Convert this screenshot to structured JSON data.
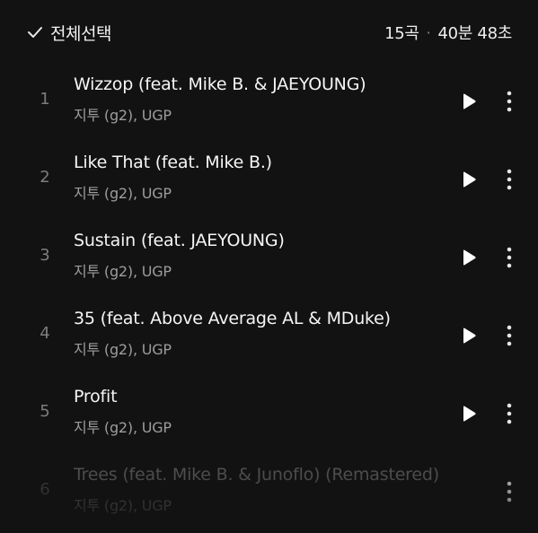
{
  "header": {
    "select_all_label": "전체선택",
    "track_count": "15곡",
    "separator": "·",
    "total_duration": "40분 48초"
  },
  "tracks": [
    {
      "number": "1",
      "title": "Wizzop (feat. Mike B. & JAEYOUNG)",
      "artist": "지투 (g2), UGP"
    },
    {
      "number": "2",
      "title": "Like That (feat. Mike B.)",
      "artist": "지투 (g2), UGP"
    },
    {
      "number": "3",
      "title": "Sustain (feat. JAEYOUNG)",
      "artist": "지투 (g2), UGP"
    },
    {
      "number": "4",
      "title": "35 (feat. Above Average AL & MDuke)",
      "artist": "지투 (g2), UGP"
    },
    {
      "number": "5",
      "title": "Profit",
      "artist": "지투 (g2), UGP"
    },
    {
      "number": "6",
      "title": "Trees (feat. Mike B. & Junoflo) (Remastered)",
      "artist": "지투 (g2), UGP"
    }
  ],
  "icons": {
    "check": "check-icon",
    "play": "play-icon",
    "more": "more-vertical-icon"
  },
  "colors": {
    "background": "#121212",
    "title_text": "#f5f5f5",
    "artist_text": "#9d9d9d",
    "number_text": "#7d7d7d"
  }
}
